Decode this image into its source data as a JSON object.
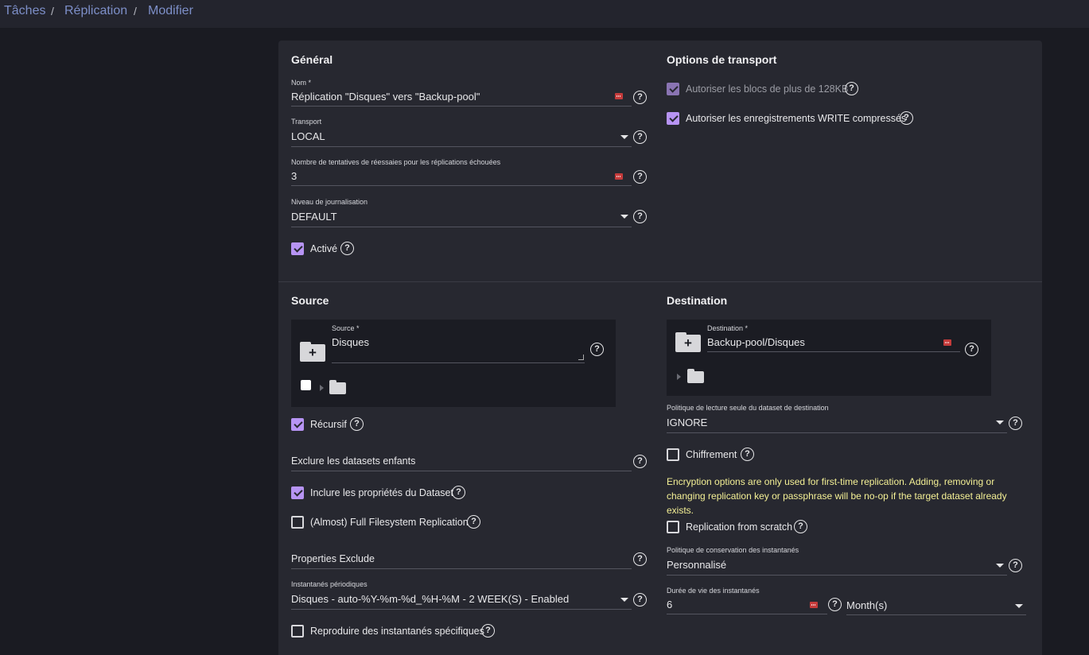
{
  "breadcrumb": [
    "Tâches",
    "Réplication",
    "Modifier"
  ],
  "general": {
    "title": "Général",
    "name_label": "Nom *",
    "name_value": "Réplication \"Disques\" vers  \"Backup-pool\"",
    "transport_label": "Transport",
    "transport_value": "LOCAL",
    "retries_label": "Nombre de tentatives de réessaies pour les réplications échouées",
    "retries_value": "3",
    "log_label": "Niveau de journalisation",
    "log_value": "DEFAULT",
    "enabled_label": "Activé"
  },
  "transport_options": {
    "title": "Options de transport",
    "large_block_label": "Autoriser les blocs de plus de 128KB",
    "compressed_label": "Autoriser les enregistrements WRITE compressés"
  },
  "source": {
    "title": "Source",
    "field_label": "Source *",
    "field_value": "Disques",
    "recursive_label": "Récursif",
    "exclude_children_placeholder": "Exclure les datasets enfants",
    "include_props_label": "Inclure les propriétés du Dataset",
    "full_fs_label": "(Almost) Full Filesystem Replication",
    "props_exclude_placeholder": "Properties Exclude",
    "periodic_label": "Instantanés périodiques",
    "periodic_value": "Disques - auto-%Y-%m-%d_%H-%M - 2 WEEK(S) - Enabled",
    "replicate_specific_label": "Reproduire des instantanés spécifiques"
  },
  "destination": {
    "title": "Destination",
    "field_label": "Destination *",
    "field_value": "Backup-pool/Disques",
    "readonly_label": "Politique de lecture seule du dataset de destination",
    "readonly_value": "IGNORE",
    "encryption_label": "Chiffrement",
    "encryption_note": "Encryption options are only used for first-time replication. Adding, removing or changing replication key or passphrase will be no-op if the target dataset already exists.",
    "from_scratch_label": "Replication from scratch",
    "retention_label": "Politique de conservation des instantanés",
    "retention_value": "Personnalisé",
    "lifetime_label": "Durée de vie des instantanés",
    "lifetime_value": "6",
    "lifetime_unit": "Month(s)"
  },
  "checkboxes": {
    "enabled": true,
    "large_block": true,
    "compressed": true,
    "recursive": true,
    "include_props": true,
    "full_fs": false,
    "replicate_specific": false,
    "encryption": false,
    "from_scratch": false,
    "source_tree_select": false
  },
  "colors": {
    "accent": "#b794f4",
    "note": "#f4f095",
    "breadcrumb_link": "#7d8fc8",
    "card_bg": "#272830",
    "page_bg": "#1a1b22"
  },
  "icons": [
    "help-icon",
    "caret-down-icon",
    "keypad-icon",
    "folder-plus-icon",
    "folder-icon",
    "expand-triangle-icon"
  ]
}
